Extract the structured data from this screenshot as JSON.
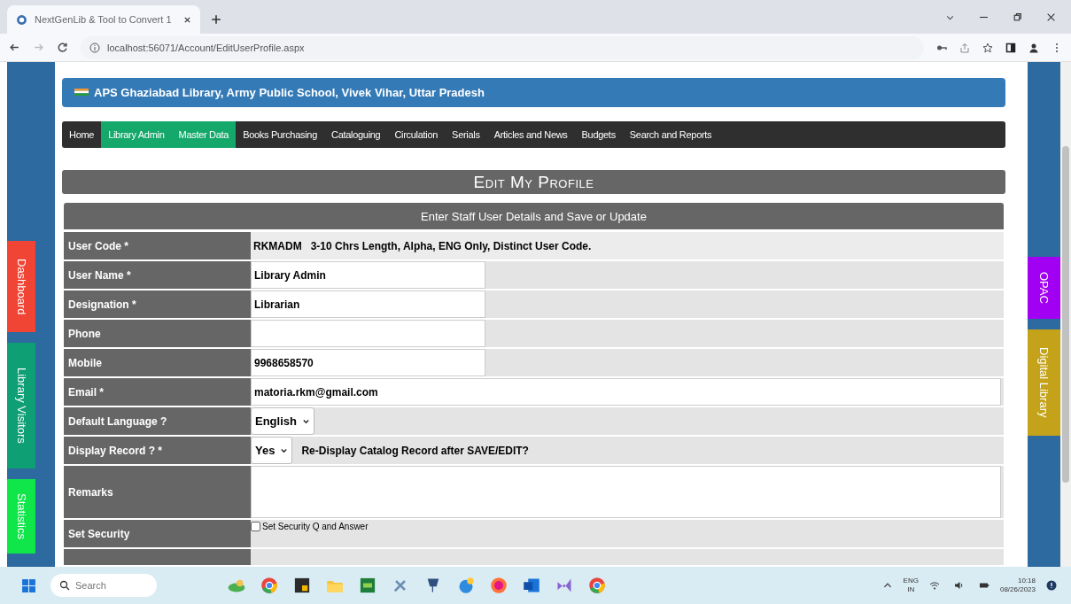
{
  "browser": {
    "tab_title": "NextGenLib & Tool to Convert 1",
    "url": "localhost:56071/Account/EditUserProfile.aspx"
  },
  "side_tabs_left": [
    {
      "label": "Dashboard",
      "color": "#f04534"
    },
    {
      "label": "Library Visitors",
      "color": "#0f9f74"
    },
    {
      "label": "Statistics",
      "color": "#10e64a"
    }
  ],
  "side_tabs_right": [
    {
      "label": "OPAC",
      "color": "#a100f2"
    },
    {
      "label": "Digital Library",
      "color": "#c4a31a"
    }
  ],
  "banner": "APS Ghaziabad Library, Army Public School, Vivek Vihar, Uttar Pradesh",
  "nav": [
    {
      "label": "Home",
      "selected": false
    },
    {
      "label": "Library Admin",
      "selected": true
    },
    {
      "label": "Master Data",
      "selected": true
    },
    {
      "label": "Books Purchasing",
      "selected": false
    },
    {
      "label": "Cataloguing",
      "selected": false
    },
    {
      "label": "Circulation",
      "selected": false
    },
    {
      "label": "Serials",
      "selected": false
    },
    {
      "label": "Articles and News",
      "selected": false
    },
    {
      "label": "Budgets",
      "selected": false
    },
    {
      "label": "Search and Reports",
      "selected": false
    }
  ],
  "page_title": "Edit My Profile",
  "form": {
    "subtitle": "Enter Staff User Details and Save or Update",
    "rows": [
      {
        "label": "User Code *",
        "kind": "code",
        "value": "RKMADM",
        "hint": "3-10 Chrs Length, Alpha, ENG Only, Distinct User Code."
      },
      {
        "label": "User Name *",
        "kind": "text",
        "value": "Library Admin"
      },
      {
        "label": "Designation *",
        "kind": "text",
        "value": "Librarian"
      },
      {
        "label": "Phone",
        "kind": "text"
      },
      {
        "label": "Mobile",
        "kind": "text",
        "value": "9968658570"
      },
      {
        "label": "Email *",
        "kind": "wide",
        "value": "matoria.rkm@gmail.com"
      },
      {
        "label": "Default Language ?",
        "kind": "select",
        "value": "English"
      },
      {
        "label": "Display Record ? *",
        "kind": "select",
        "value": "Yes",
        "hint": "Re-Display Catalog Record after SAVE/EDIT?"
      },
      {
        "label": "Remarks",
        "kind": "textarea"
      },
      {
        "label": "Set Security",
        "kind": "checkbox",
        "checked": false,
        "hint": "Set Security Q and Answer"
      }
    ]
  },
  "taskbar": {
    "search_placeholder": "Search",
    "language": "ENG",
    "region": "IN",
    "time": "10:18",
    "date": "08/26/2023"
  }
}
